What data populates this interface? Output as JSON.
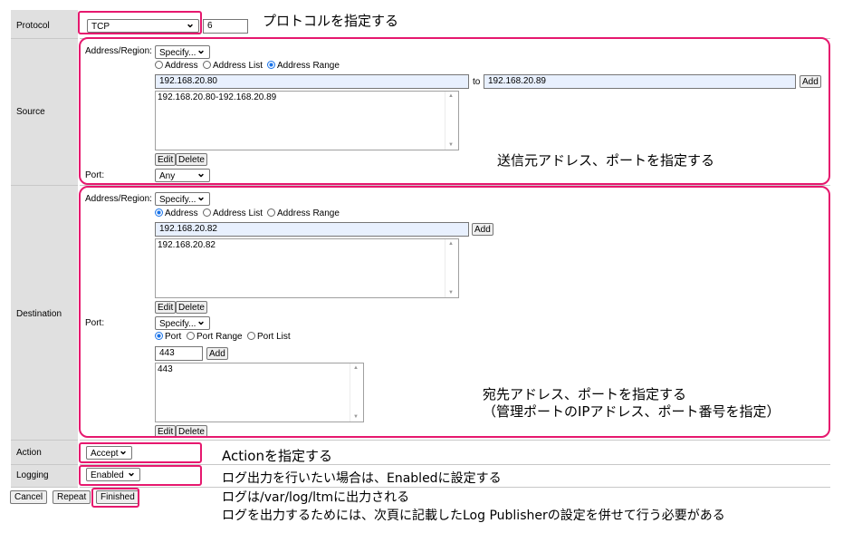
{
  "protocol": {
    "label": "Protocol",
    "select": "TCP",
    "number": "6"
  },
  "source": {
    "label": "Source",
    "addr_region_label": "Address/Region:",
    "specify": "Specify...",
    "radio_address": "Address",
    "radio_list": "Address List",
    "radio_range": "Address Range",
    "range_from": "192.168.20.80",
    "to_label": "to",
    "range_to": "192.168.20.89",
    "add": "Add",
    "list_item": "192.168.20.80-192.168.20.89",
    "edit": "Edit",
    "delete": "Delete",
    "port_label": "Port:",
    "port_select": "Any"
  },
  "destination": {
    "label": "Destination",
    "addr_region_label": "Address/Region:",
    "specify": "Specify...",
    "radio_address": "Address",
    "radio_list": "Address List",
    "radio_range": "Address Range",
    "address": "192.168.20.82",
    "add": "Add",
    "list_item": "192.168.20.82",
    "edit": "Edit",
    "delete": "Delete",
    "port_label": "Port:",
    "port_specify": "Specify...",
    "radio_port": "Port",
    "radio_port_range": "Port Range",
    "radio_port_list": "Port List",
    "port_value": "443",
    "port_add": "Add",
    "port_list_item": "443",
    "port_edit": "Edit",
    "port_delete": "Delete"
  },
  "action": {
    "label": "Action",
    "select": "Accept"
  },
  "logging": {
    "label": "Logging",
    "select": "Enabled"
  },
  "buttons": {
    "cancel": "Cancel",
    "repeat": "Repeat",
    "finished": "Finished"
  },
  "annotations": {
    "protocol": "プロトコルを指定する",
    "source": "送信元アドレス、ポートを指定する",
    "dest_line1": "宛先アドレス、ポートを指定する",
    "dest_line2": "（管理ポートのIPアドレス、ポート番号を指定）",
    "action": "Actionを指定する",
    "logging_line1": "ログ出力を行いたい場合は、Enabledに設定する",
    "logging_line2": "ログは/var/log/ltmに出力される",
    "logging_line3": "ログを出力するためには、次頁に記載したLog Publisherの設定を併せて行う必要がある"
  },
  "colors": {
    "highlight": "#e6186e",
    "label_bg": "#e0e0e0",
    "input_fill": "#e8f0fe",
    "radio_on": "#1a73e8"
  }
}
